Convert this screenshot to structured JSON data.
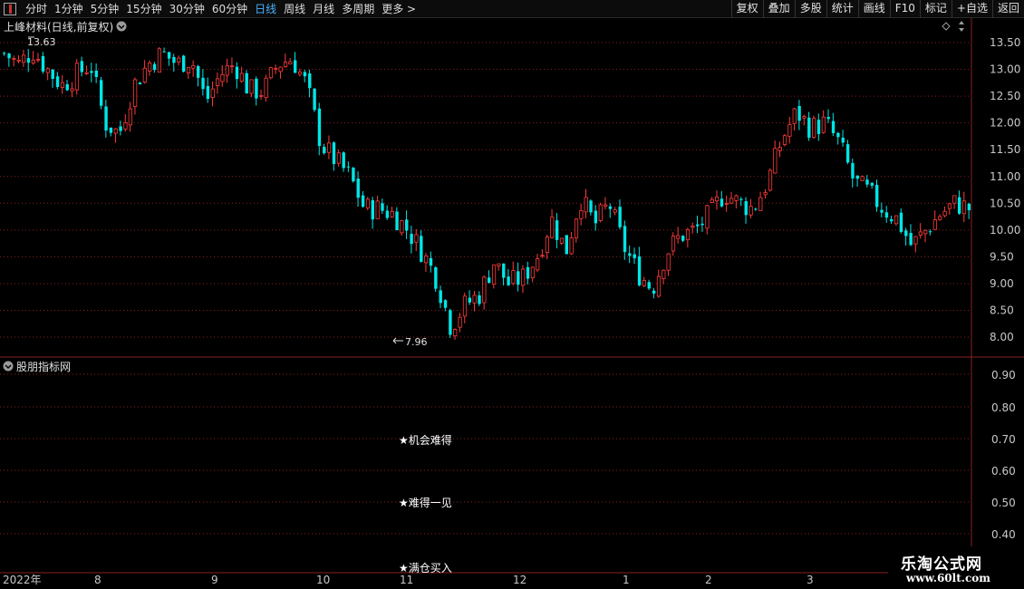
{
  "toolbar": {
    "periods": [
      {
        "label": "分时",
        "active": false
      },
      {
        "label": "1分钟",
        "active": false
      },
      {
        "label": "5分钟",
        "active": false
      },
      {
        "label": "15分钟",
        "active": false
      },
      {
        "label": "30分钟",
        "active": false
      },
      {
        "label": "60分钟",
        "active": false
      },
      {
        "label": "日线",
        "active": true
      },
      {
        "label": "周线",
        "active": false
      },
      {
        "label": "月线",
        "active": false
      },
      {
        "label": "多周期",
        "active": false
      },
      {
        "label": "更多 >",
        "active": false
      }
    ],
    "buttons": [
      "复权",
      "叠加",
      "多股",
      "统计",
      "画线",
      "F10",
      "标记",
      "+自选",
      "返回"
    ]
  },
  "main_panel": {
    "title": "上峰材料(日线,前复权)",
    "price_axis": [
      "13.50",
      "13.00",
      "12.50",
      "12.00",
      "11.50",
      "11.00",
      "10.50",
      "10.00",
      "9.50",
      "9.00",
      "8.50",
      "8.00"
    ],
    "high_label": "13.63",
    "low_label": "7.96"
  },
  "indicator_panel": {
    "title": "股朋指标网",
    "axis": [
      "0.90",
      "0.80",
      "0.70",
      "0.60",
      "0.50",
      "0.40"
    ],
    "signals": [
      {
        "text": "★机会难得"
      },
      {
        "text": "★难得一见"
      },
      {
        "text": "★满仓买入"
      }
    ]
  },
  "date_axis": [
    "2022年",
    "8",
    "9",
    "10",
    "11",
    "12",
    "1",
    "2",
    "3"
  ],
  "watermark": {
    "title": "乐淘公式网",
    "url": "www.60lt.com"
  },
  "colors": {
    "up": "#ff3b3b",
    "down": "#00e6e6",
    "grid": "#8a1f1f",
    "axis_text": "#c8c8c8",
    "active_tab": "#4ab0ff"
  },
  "chart_data": {
    "type": "candlestick",
    "title": "上峰材料(日线,前复权)",
    "y_range": [
      7.9,
      13.75
    ],
    "y_ticks": [
      8.0,
      8.5,
      9.0,
      9.5,
      10.0,
      10.5,
      11.0,
      11.5,
      12.0,
      12.5,
      13.0,
      13.5
    ],
    "x_month_labels": [
      "2022年",
      "8",
      "9",
      "10",
      "11",
      "12",
      "1",
      "2",
      "3"
    ],
    "highest": 13.63,
    "lowest": 7.96,
    "close_path": [
      13.3,
      13.1,
      13.35,
      13.0,
      12.7,
      12.9,
      13.1,
      12.0,
      11.8,
      12.7,
      13.1,
      13.3,
      13.1,
      13.2,
      12.4,
      12.9,
      13.1,
      12.6,
      12.6,
      13.1,
      13.2,
      12.7,
      11.6,
      11.3,
      11.0,
      10.4,
      10.4,
      10.3,
      10.0,
      9.6,
      9.1,
      8.2,
      8.6,
      8.8,
      9.4,
      9.0,
      9.1,
      9.5,
      10.2,
      9.6,
      10.6,
      10.1,
      10.5,
      9.7,
      9.2,
      8.9,
      9.6,
      9.9,
      10.0,
      10.3,
      10.7,
      10.5,
      10.4,
      10.9,
      11.7,
      12.2,
      11.9,
      12.0,
      11.6,
      10.9,
      10.7,
      10.4,
      10.2,
      9.7,
      10.0,
      10.3,
      10.5,
      10.4
    ]
  }
}
